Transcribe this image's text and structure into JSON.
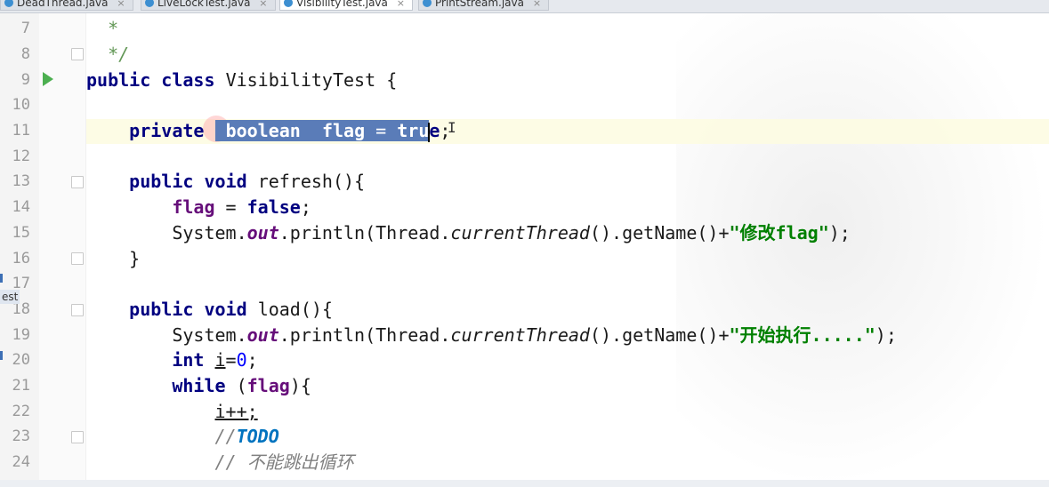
{
  "tabs": [
    {
      "label": "DeadThread.java"
    },
    {
      "label": "LiveLockTest.java"
    },
    {
      "label": "VisibilityTest.java"
    },
    {
      "label": "PrintStream.java"
    }
  ],
  "tab_close_glyph": "×",
  "side_panel_label": "est",
  "line_numbers": [
    "7",
    "8",
    "9",
    "10",
    "11",
    "12",
    "13",
    "14",
    "15",
    "16",
    "17",
    "18",
    "19",
    "20",
    "21",
    "22",
    "23",
    "24"
  ],
  "code": {
    "l7_star": "*",
    "l8_close": "*/",
    "l9_public": "public",
    "l9_class": "class",
    "l9_name": "VisibilityTest",
    "l9_brace": "{",
    "l11_private": "private",
    "l11_boolean": "boolean",
    "l11_flag": "flag",
    "l11_eq": " = ",
    "l11_tr": "tru",
    "l11_e": "e",
    "l11_semi": ";",
    "l13_public": "public",
    "l13_void": "void",
    "l13_sig": "refresh(){",
    "l14_flag": "flag",
    "l14_eq": " = ",
    "l14_false": "false",
    "l14_semi": ";",
    "l15_sys": "System.",
    "l15_out": "out",
    "l15_println": ".println(Thread.",
    "l15_ct": "currentThread",
    "l15_rest": "().getName()+",
    "l15_str": "\"修改flag\"",
    "l15_end": ");",
    "l16_brace": "}",
    "l18_public": "public",
    "l18_void": "void",
    "l18_sig": "load(){",
    "l19_sys": "System.",
    "l19_out": "out",
    "l19_println": ".println(Thread.",
    "l19_ct": "currentThread",
    "l19_rest": "().getName()+",
    "l19_str": "\"开始执行.....\"",
    "l19_end": ");",
    "l20_int": "int",
    "l20_var": "i",
    "l20_eq": "=",
    "l20_zero": "0",
    "l20_semi": ";",
    "l21_while": "while",
    "l21_open": " (",
    "l21_flag": "flag",
    "l21_close": "){",
    "l22_inc": "i++;",
    "l23_slashes": "//",
    "l23_todo": "TODO",
    "l24_cmt": "// 不能跳出循环"
  },
  "colors": {
    "keyword": "#000080",
    "field": "#660e7a",
    "string": "#008000",
    "number": "#0000ff",
    "comment": "#808080",
    "todo": "#0073bf",
    "selection": "#5a7cb8",
    "current_line": "#fdfce1",
    "run_icon": "#4caf50"
  },
  "icons": {
    "run": "run-gutter-icon",
    "tab_file": "java-class-icon",
    "fold": "fold-marker-icon"
  }
}
